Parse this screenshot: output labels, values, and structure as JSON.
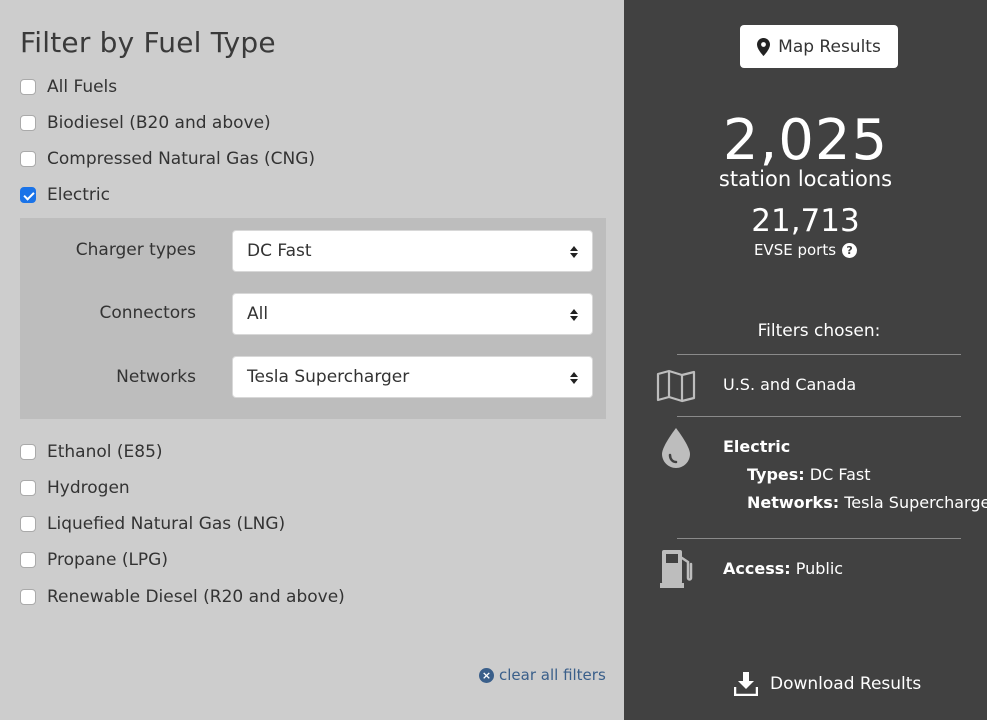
{
  "filter": {
    "title": "Filter by Fuel Type",
    "fuels_top": [
      {
        "label": "All Fuels",
        "checked": false
      },
      {
        "label": "Biodiesel (B20 and above)",
        "checked": false
      },
      {
        "label": "Compressed Natural Gas (CNG)",
        "checked": false
      },
      {
        "label": "Electric",
        "checked": true
      }
    ],
    "electric": {
      "charger_types": {
        "label": "Charger types",
        "value": "DC Fast"
      },
      "connectors": {
        "label": "Connectors",
        "value": "All"
      },
      "networks": {
        "label": "Networks",
        "value": "Tesla Supercharger"
      }
    },
    "fuels_bottom": [
      {
        "label": "Ethanol (E85)",
        "checked": false
      },
      {
        "label": "Hydrogen",
        "checked": false
      },
      {
        "label": "Liquefied Natural Gas (LNG)",
        "checked": false
      },
      {
        "label": "Propane (LPG)",
        "checked": false
      },
      {
        "label": "Renewable Diesel (R20 and above)",
        "checked": false
      }
    ],
    "clear_label": "clear all filters"
  },
  "results": {
    "map_button": "Map Results",
    "station_count": "2,025",
    "station_label": "station locations",
    "port_count": "21,713",
    "port_label": "EVSE ports",
    "help_glyph": "?",
    "filters_title": "Filters chosen:",
    "location": "U.S. and Canada",
    "fuel_name": "Electric",
    "types_key": "Types:",
    "types_value": "DC Fast",
    "networks_key": "Networks:",
    "networks_value": "Tesla Supercharger",
    "access_key": "Access:",
    "access_value": "Public",
    "download_label": "Download Results"
  },
  "icons": {
    "map_pin": "map-pin-icon",
    "map": "map-icon",
    "drop": "drop-icon",
    "fuel_pump": "fuel-pump-icon",
    "download": "download-icon",
    "clear": "close-circle-icon",
    "help": "help-icon"
  },
  "colors": {
    "left_bg": "#cdcdcd",
    "right_bg": "#414141",
    "checkbox_checked": "#1a73e8",
    "link": "#3a5f8a"
  }
}
